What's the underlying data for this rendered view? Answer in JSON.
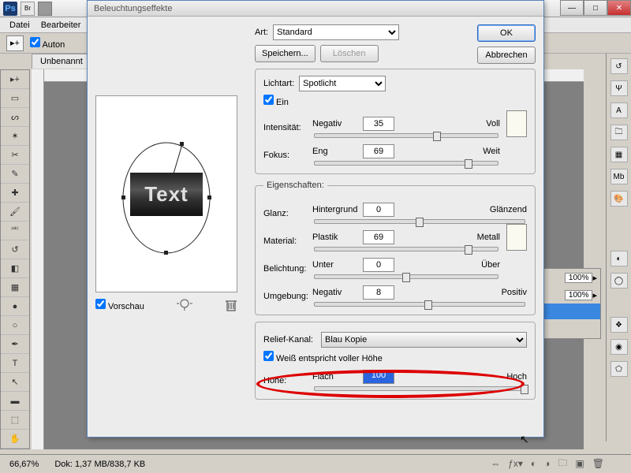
{
  "app": {
    "ps": "Ps",
    "br": "Br"
  },
  "window": {
    "minimize": "—",
    "maximize": "□",
    "close": "✕"
  },
  "menu": {
    "file": "Datei",
    "edit": "Bearbeiter"
  },
  "options": {
    "auto": "Auton"
  },
  "doc": {
    "tab": "Unbenannt"
  },
  "status": {
    "zoom": "66,67%",
    "doc": "Dok: 1,37 MB/838,7 KB"
  },
  "layers": {
    "opacity1": "100%",
    "opacity2": "100%"
  },
  "dialog": {
    "title": "Beleuchtungseffekte",
    "ok": "OK",
    "cancel": "Abbrechen",
    "save": "Speichern...",
    "delete": "Löschen",
    "art_label": "Art:",
    "art_value": "Standard",
    "preview_label": "Vorschau",
    "preview_text": "Text",
    "light": {
      "legend": "Lichtart:",
      "value": "Spotlicht",
      "on": "Ein",
      "intensity_label": "Intensität:",
      "intensity_left": "Negativ",
      "intensity_val": "35",
      "intensity_right": "Voll",
      "focus_label": "Fokus:",
      "focus_left": "Eng",
      "focus_val": "69",
      "focus_right": "Weit"
    },
    "props": {
      "legend": "Eigenschaften:",
      "gloss_label": "Glanz:",
      "gloss_left": "Hintergrund",
      "gloss_val": "0",
      "gloss_right": "Glänzend",
      "material_label": "Material:",
      "material_left": "Plastik",
      "material_val": "69",
      "material_right": "Metall",
      "exposure_label": "Belichtung:",
      "exposure_left": "Unter",
      "exposure_val": "0",
      "exposure_right": "Über",
      "ambience_label": "Umgebung:",
      "ambience_left": "Negativ",
      "ambience_val": "8",
      "ambience_right": "Positiv"
    },
    "texture": {
      "label": "Relief-Kanal:",
      "value": "Blau Kopie",
      "white": "Weiß entspricht voller Höhe",
      "height_label": "Höhe:",
      "height_left": "Flach",
      "height_val": "100",
      "height_right": "Hoch"
    }
  }
}
